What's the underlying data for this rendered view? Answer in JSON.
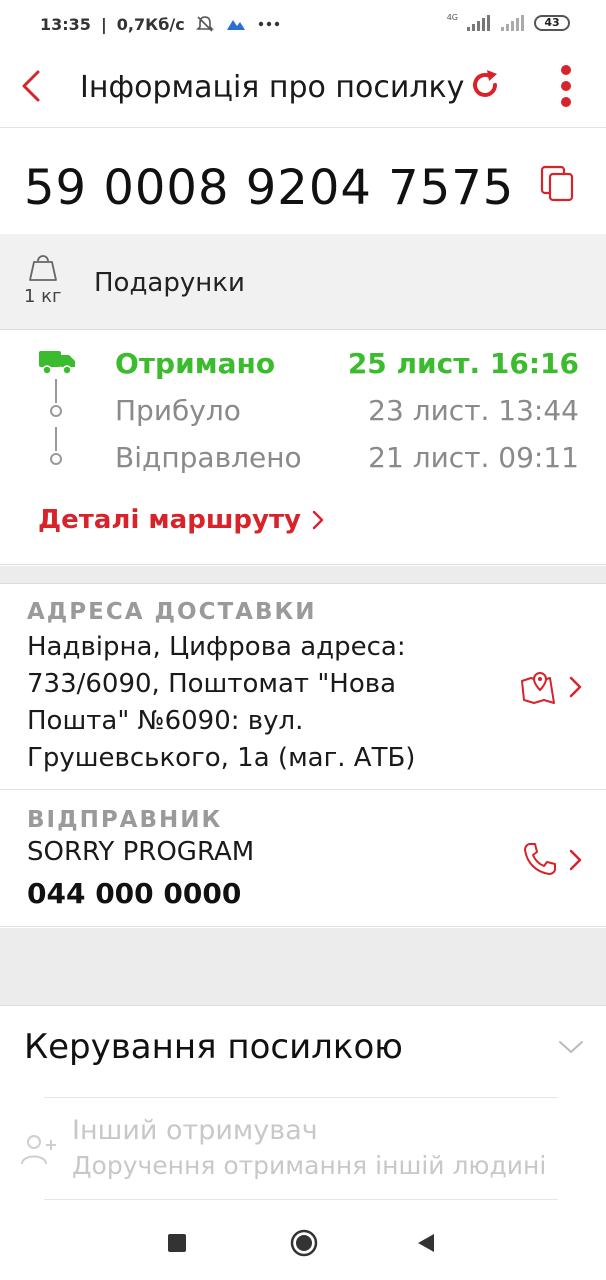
{
  "status_bar": {
    "time": "13:35",
    "speed": "0,7Кб/с",
    "network_label": "4G",
    "battery": "43",
    "icons": [
      "mute-icon",
      "cloud-icon",
      "more-dots-icon",
      "signal-icon",
      "signal-icon",
      "battery-icon"
    ]
  },
  "app_bar": {
    "title": "Інформація про посилку",
    "back_icon": "chevron-left-icon",
    "refresh_icon": "refresh-icon",
    "menu_icon": "more-vertical-icon"
  },
  "parcel": {
    "tracking_number": "59 0008 9204 7575",
    "weight": "1 кг",
    "description": "Подарунки"
  },
  "tracking_history": [
    {
      "status": "Отримано",
      "date": "25 лист. 16:16",
      "active": true
    },
    {
      "status": "Прибуло",
      "date": "23 лист. 13:44",
      "active": false
    },
    {
      "status": "Відправлено",
      "date": "21 лист. 09:11",
      "active": false
    }
  ],
  "route_link": "Деталі маршруту",
  "delivery_address": {
    "label": "АДРЕСА ДОСТАВКИ",
    "text": "Надвірна, Цифрова адреса: 733/6090, Поштомат \"Нова Пошта\" №6090: вул. Грушевського, 1а (маг. АТБ)"
  },
  "sender": {
    "label": "ВІДПРАВНИК",
    "name": "SORRY PROGRAM",
    "phone": "044 000 0000"
  },
  "manage": {
    "title": "Керування посилкою",
    "option_title": "Інший отримувач",
    "option_desc": "Доручення отримання іншій людині"
  },
  "colors": {
    "brand_red": "#d8232a",
    "success_green": "#3bbc2e",
    "muted_gray": "#8a8a8a"
  }
}
